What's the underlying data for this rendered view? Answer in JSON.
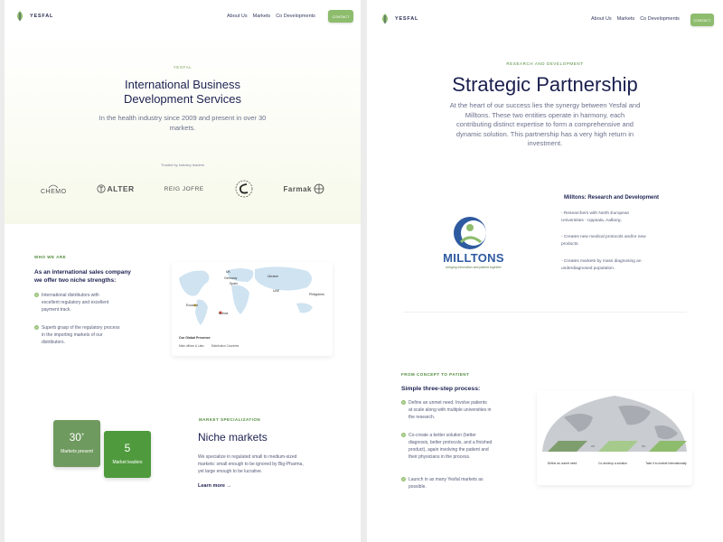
{
  "left": {
    "nav": {
      "brand": "YESFAL",
      "links": [
        "About Us",
        "Markets",
        "Co Developments"
      ],
      "cta": "CONTACT"
    },
    "hero": {
      "eyebrow": "YESFAL",
      "title_line1": "International Business",
      "title_line2": "Development Services",
      "subtitle_line1": "In the health industry since 2009 and present in over 30",
      "subtitle_line2": "markets.",
      "trusted": "Trusted by industry leaders",
      "logos": [
        "CHEMO",
        "ALTER",
        "REIG JOFRE",
        "",
        "Farmak"
      ]
    },
    "who": {
      "label": "WHO WE ARE",
      "title_line1": "As an international sales company",
      "title_line2": "we offer two niche strengths:",
      "bullets": [
        [
          "International distributors with",
          "excellent regulatory and excellent",
          "payment track."
        ],
        [
          "Superb grasp of the regulatory process",
          "in the importing markets of our",
          "distributors."
        ]
      ]
    },
    "map": {
      "pins": [
        "UK",
        "Germany",
        "Spain",
        "Ukraine",
        "UAE",
        "Philippines",
        "Ecuador",
        "Bolivia"
      ],
      "legend_title": "Our Global Presence",
      "legend_items": [
        "Main offices & Labs",
        "Distribution Countries"
      ]
    },
    "stats": [
      {
        "num": "30",
        "sup": "+",
        "label": "Markets present",
        "color": "#6f9a5f"
      },
      {
        "num": "5",
        "sup": "",
        "label": "Market leaders",
        "color": "#4f9a3d"
      }
    ],
    "niche": {
      "label": "MARKET SPECIALIZATION",
      "title": "Niche markets",
      "text_lines": [
        "We specialize in regulated small to medium-sized",
        "markets: small enough to be ignored by Big-Pharma,",
        "yet large enough to be lucrative."
      ],
      "link": "Learn more"
    }
  },
  "right": {
    "nav": {
      "brand": "YESFAL",
      "links": [
        "About Us",
        "Markets",
        "Co Developments"
      ],
      "cta": "CONTACT"
    },
    "hero": {
      "eyebrow": "RESEARCH AND DEVELOPMENT",
      "title": "Strategic Partnership",
      "lines": [
        "At the heart of our success lies the synergy between Yesfal and",
        "Milltons. These two entities operate in harmony, each",
        "contributing distinct expertise to form a comprehensive and",
        "dynamic solution. This partnership has a very high return in",
        "investment."
      ]
    },
    "milltons": {
      "name": "MILLTONS",
      "tagline": "bringing innovation and patient together",
      "heading": "Milltons: Research and Development",
      "bullets": [
        [
          "- Researchers with North European",
          "Universities - Uppsala, Aalborg."
        ],
        [
          "- Creates new medical protocols and/or new",
          "products."
        ],
        [
          "- Creates markets by mass diagnosing an",
          "underdiagnosed population."
        ]
      ]
    },
    "concept": {
      "label": "FROM CONCEPT TO PATIENT",
      "title": "Simple three-step process:",
      "bullets": [
        [
          "Define an unmet need. Involve patients",
          "at scale along with multiple universities in",
          "the research."
        ],
        [
          "Co-create a better solution (better",
          "diagnosis, better protocols, and a finished",
          "product), again involving the patient and",
          "their physicians in the process."
        ],
        [
          "Launch in as many Yesfal markets as",
          "possible."
        ]
      ],
      "steps": [
        "Define an unmet need",
        "Co-develop a solution",
        "Take it to market internationally"
      ]
    }
  },
  "colors": {
    "green": "#8ebc6d",
    "navy": "#1c2150"
  }
}
